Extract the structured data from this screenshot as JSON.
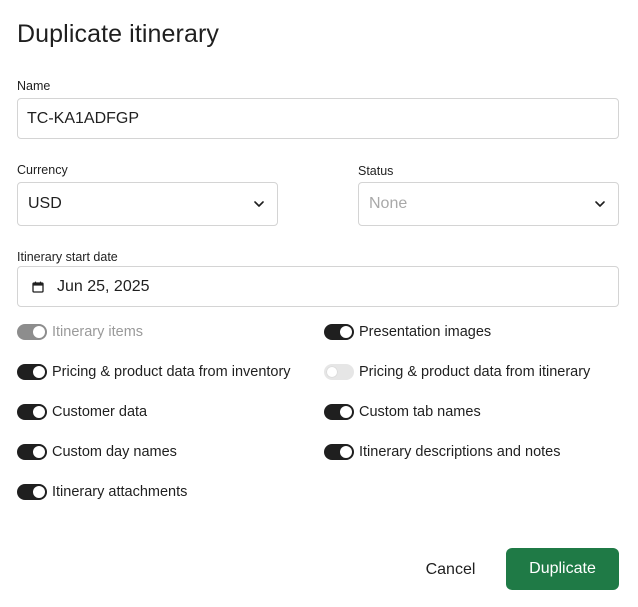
{
  "dialog": {
    "title": "Duplicate itinerary"
  },
  "form": {
    "name": {
      "label": "Name",
      "value": "TC-KA1ADFGP"
    },
    "currency": {
      "label": "Currency",
      "value": "USD"
    },
    "status": {
      "label": "Status",
      "placeholder": "None"
    },
    "start_date": {
      "label": "Itinerary start date",
      "value": "Jun 25, 2025"
    }
  },
  "toggles": [
    {
      "label": "Itinerary items",
      "checked": true,
      "disabled": true
    },
    {
      "label": "Presentation images",
      "checked": true,
      "disabled": false
    },
    {
      "label": "Pricing & product data from inventory",
      "checked": true,
      "disabled": false
    },
    {
      "label": "Pricing & product data from itinerary",
      "checked": false,
      "disabled": false
    },
    {
      "label": "Customer data",
      "checked": true,
      "disabled": false
    },
    {
      "label": "Custom tab names",
      "checked": true,
      "disabled": false
    },
    {
      "label": "Custom day names",
      "checked": true,
      "disabled": false
    },
    {
      "label": "Itinerary descriptions and notes",
      "checked": true,
      "disabled": false
    },
    {
      "label": "Itinerary attachments",
      "checked": true,
      "disabled": false
    }
  ],
  "actions": {
    "cancel_label": "Cancel",
    "duplicate_label": "Duplicate"
  },
  "colors": {
    "primary": "#1f7a46",
    "toggle_on": "#1f1f1f",
    "toggle_disabled": "#8d8d8d",
    "toggle_off": "#e6e6e6"
  },
  "icons": {
    "currency_dropdown": "chevron-down-icon",
    "status_dropdown": "chevron-down-icon",
    "date_field": "calendar-icon"
  }
}
